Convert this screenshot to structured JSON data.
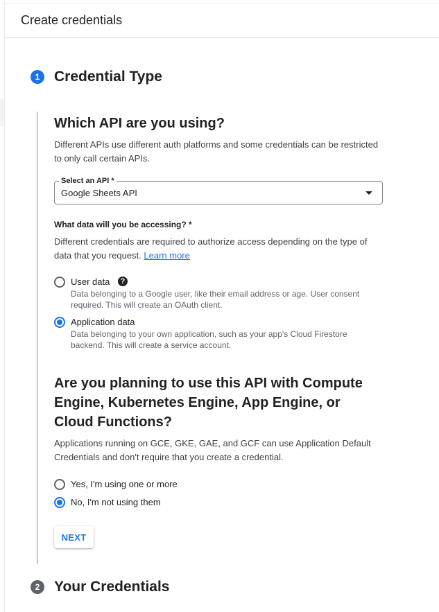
{
  "header": {
    "title": "Create credentials"
  },
  "steps": [
    {
      "number": "1",
      "title": "Credential Type",
      "state": "active"
    },
    {
      "number": "2",
      "title": "Your Credentials",
      "state": "inactive"
    }
  ],
  "api_section": {
    "heading": "Which API are you using?",
    "description": "Different APIs use different auth platforms and some credentials can be restricted to only call certain APIs.",
    "select": {
      "label": "Select an API *",
      "value": "Google Sheets API"
    }
  },
  "data_section": {
    "label": "What data will you be accessing? *",
    "description": "Different credentials are required to authorize access depending on the type of data that you request.",
    "learn_more": "Learn more",
    "options": [
      {
        "label": "User data",
        "description": "Data belonging to a Google user, like their email address or age. User consent required. This will create an OAuth client.",
        "selected": false,
        "help_icon": "?"
      },
      {
        "label": "Application data",
        "description": "Data belonging to your own application, such as your app's Cloud Firestore backend. This will create a service account.",
        "selected": true
      }
    ]
  },
  "compute_section": {
    "heading": "Are you planning to use this API with Compute Engine, Kubernetes Engine, App Engine, or Cloud Functions?",
    "description": "Applications running on GCE, GKE, GAE, and GCF can use Application Default Credentials and don't require that you create a credential.",
    "options": [
      {
        "label": "Yes, I'm using one or more",
        "selected": false
      },
      {
        "label": "No, I'm not using them",
        "selected": true
      }
    ]
  },
  "next_button": {
    "label": "NEXT"
  },
  "colors": {
    "accent": "#1a73e8",
    "text": "#202124",
    "secondary_text": "#5f6368",
    "inactive_step": "#5f6368"
  },
  "icons": {
    "dropdown": "chevron-down-icon",
    "help": "help-icon"
  }
}
